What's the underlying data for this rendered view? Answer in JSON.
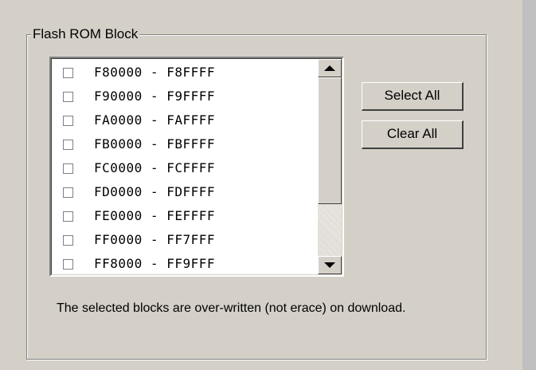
{
  "group": {
    "title": "Flash ROM Block"
  },
  "blocks": [
    {
      "label": "F80000 - F8FFFF",
      "checked": false
    },
    {
      "label": "F90000 - F9FFFF",
      "checked": false
    },
    {
      "label": "FA0000 - FAFFFF",
      "checked": false
    },
    {
      "label": "FB0000 - FBFFFF",
      "checked": false
    },
    {
      "label": "FC0000 - FCFFFF",
      "checked": false
    },
    {
      "label": "FD0000 - FDFFFF",
      "checked": false
    },
    {
      "label": "FE0000 - FEFFFF",
      "checked": false
    },
    {
      "label": "FF0000 - FF7FFF",
      "checked": false
    },
    {
      "label": "FF8000 - FF9FFF",
      "checked": false
    }
  ],
  "buttons": {
    "select_all": "Select All",
    "clear_all": "Clear All"
  },
  "note": "The selected blocks are over-written (not erace) on download."
}
